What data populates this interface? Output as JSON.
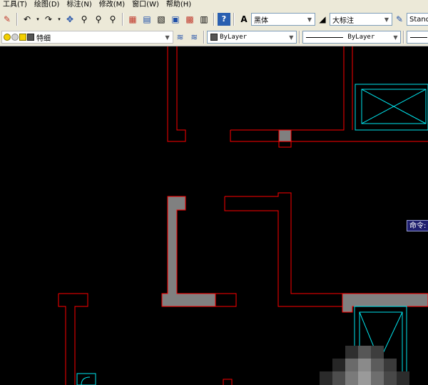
{
  "menu": {
    "items": [
      {
        "label": "工具(T)"
      },
      {
        "label": "绘图(D)"
      },
      {
        "label": "标注(N)"
      },
      {
        "label": "修改(M)"
      },
      {
        "label": "窗口(W)"
      },
      {
        "label": "帮助(H)"
      }
    ]
  },
  "toolbar": {
    "text_style": "黑体",
    "dim_style": "大标注",
    "table_style": "Stand"
  },
  "layers": {
    "current_layer": "特细",
    "color": "ByLayer",
    "linetype": "ByLayer"
  },
  "canvas": {
    "command_label": "命令:"
  },
  "colors": {
    "wall_line": "#ff0000",
    "wall_fill": "#808080",
    "fixture_line": "#00e5ee",
    "background": "#000000"
  }
}
